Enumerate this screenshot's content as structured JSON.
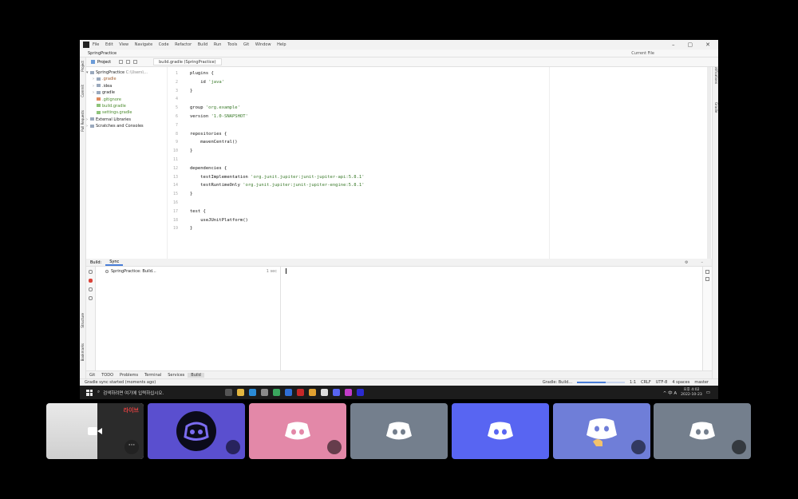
{
  "window": {
    "title": "SpringPractice",
    "menu": [
      "File",
      "Edit",
      "View",
      "Navigate",
      "Code",
      "Refactor",
      "Build",
      "Run",
      "Tools",
      "Git",
      "Window",
      "Help"
    ],
    "run_config": "Current File"
  },
  "project_panel": {
    "label": "Project",
    "tab_label": "build.gradle (SpringPractice)",
    "root": "SpringPractice",
    "root_path": "C:\\Users\\...",
    "items": [
      ".gradle",
      ".idea",
      "gradle",
      ".gitignore",
      "build.gradle",
      "settings.gradle"
    ],
    "external": "External Libraries",
    "scratches": "Scratches and Consoles"
  },
  "side_tabs_left": [
    "Project",
    "Commit",
    "Pull Requests",
    "Structure",
    "Bookmarks"
  ],
  "side_tabs_right": [
    "Notifications",
    "Gradle"
  ],
  "editor": {
    "line_numbers": [
      "1",
      "2",
      "3",
      "4",
      "5",
      "6",
      "7",
      "8",
      "9",
      "10",
      "11",
      "12",
      "13",
      "14",
      "15",
      "16",
      "17",
      "18",
      "19"
    ],
    "lines": [
      {
        "code": "plugins {",
        "str": ""
      },
      {
        "code": "    id ",
        "str": "'java'"
      },
      {
        "code": "}",
        "str": ""
      },
      {
        "code": "",
        "str": ""
      },
      {
        "code": "group ",
        "str": "'org.example'"
      },
      {
        "code": "version ",
        "str": "'1.0-SNAPSHOT'"
      },
      {
        "code": "",
        "str": ""
      },
      {
        "code": "repositories {",
        "str": ""
      },
      {
        "code": "    mavenCentral()",
        "str": ""
      },
      {
        "code": "}",
        "str": ""
      },
      {
        "code": "",
        "str": ""
      },
      {
        "code": "dependencies {",
        "str": ""
      },
      {
        "code": "    testImplementation ",
        "str": "'org.junit.jupiter:junit-jupiter-api:5.8.1'"
      },
      {
        "code": "    testRuntimeOnly ",
        "str": "'org.junit.jupiter:junit-jupiter-engine:5.8.1'"
      },
      {
        "code": "}",
        "str": ""
      },
      {
        "code": "",
        "str": ""
      },
      {
        "code": "test {",
        "str": ""
      },
      {
        "code": "    useJUnitPlatform()",
        "str": ""
      },
      {
        "code": "}",
        "str": ""
      }
    ]
  },
  "build_panel": {
    "tabs": [
      "Build:",
      "Sync"
    ],
    "task": "SpringPractice: Build...",
    "time": "1 sec"
  },
  "bottom_tabs": [
    "Git",
    "TODO",
    "Problems",
    "Terminal",
    "Services",
    "Build"
  ],
  "status": {
    "message": "Gradle sync started (moments ago)",
    "progress_label": "Gradle: Build...",
    "progress": 0.6,
    "cursor": "1:1",
    "line_sep": "CRLF",
    "encoding": "UTF-8",
    "indent": "4 spaces",
    "branch": "master"
  },
  "taskbar": {
    "search_placeholder": "검색하려면 여기에 입력하십시오.",
    "tray_lang": "^ 中 A",
    "time": "오후 4:02",
    "date": "2022-10-23"
  },
  "call": {
    "live_label": "라이브",
    "colors": {
      "tile1": "#5a4fcf",
      "tile2": "#e388a8",
      "tile3": "#747f8d",
      "tile4": "#5865f2",
      "tile5": "#6f7ed8",
      "tile6": "#747f8d"
    }
  }
}
